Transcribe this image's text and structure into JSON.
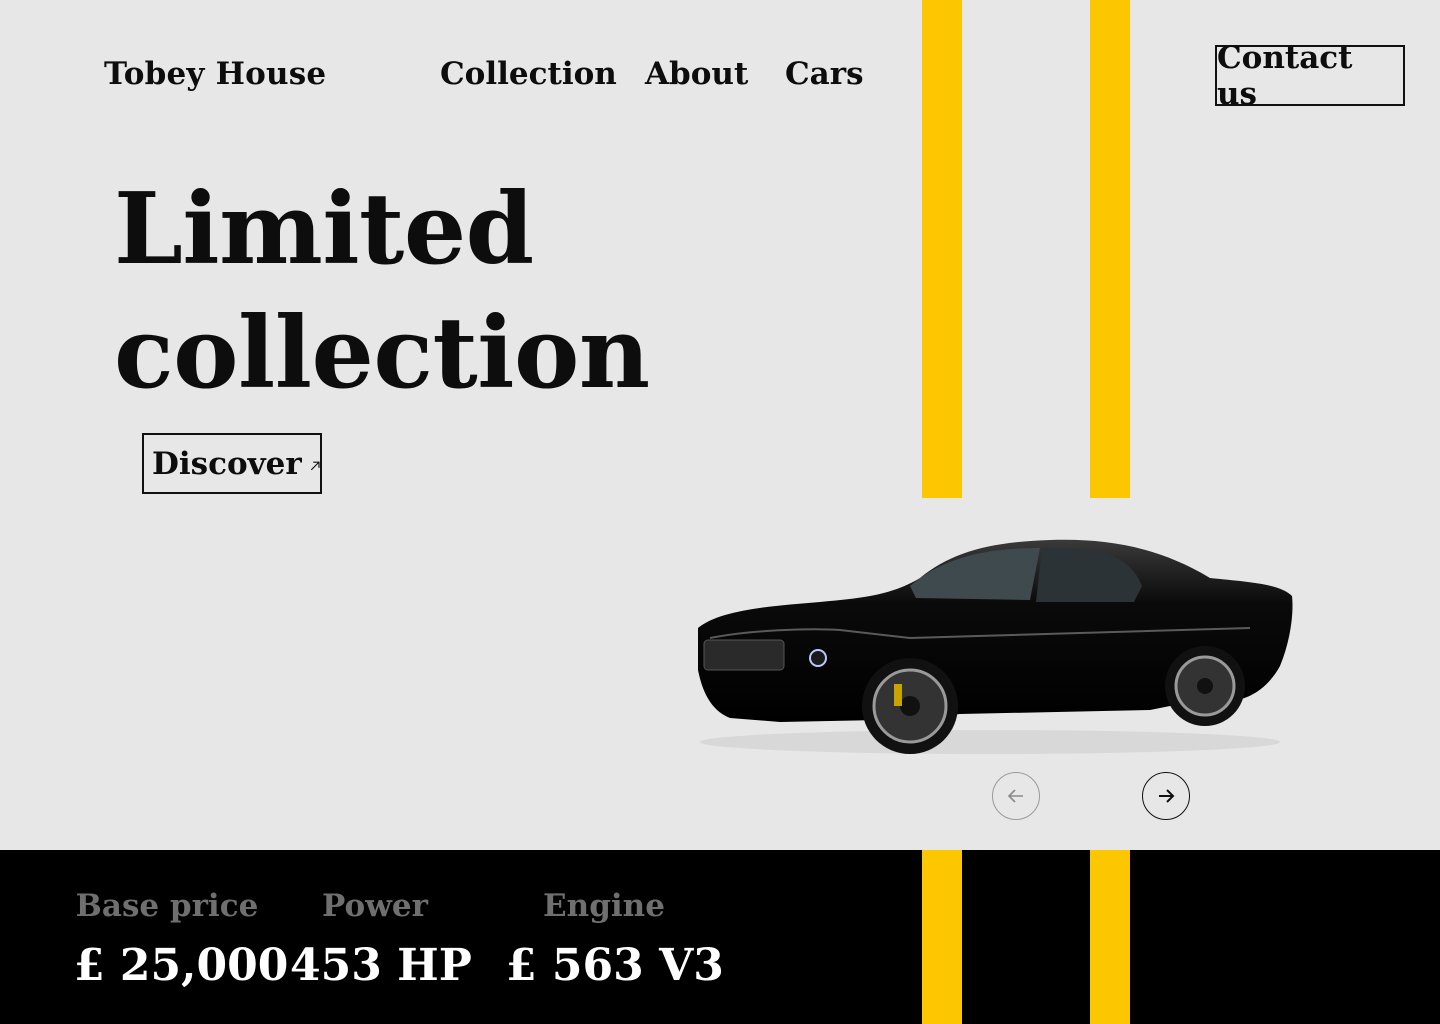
{
  "header": {
    "brand": "Tobey House",
    "nav": [
      "Collection",
      "About",
      "Cars"
    ],
    "contact_label": "Contact us"
  },
  "hero": {
    "title_line1": "Limited",
    "title_line2": "collection",
    "cta_label": "Discover"
  },
  "carousel": {
    "prev_icon": "arrow-left-icon",
    "next_icon": "arrow-right-icon"
  },
  "specs": [
    {
      "label": "Base price",
      "value": "£ 25,000"
    },
    {
      "label": "Power",
      "value": "453 HP"
    },
    {
      "label": "Engine",
      "value": "£ 563 V3"
    }
  ],
  "colors": {
    "background": "#e7e7e7",
    "accent": "#fdc700",
    "footer": "#000000",
    "text": "#0d0d0d",
    "muted": "#6f6f6f"
  }
}
